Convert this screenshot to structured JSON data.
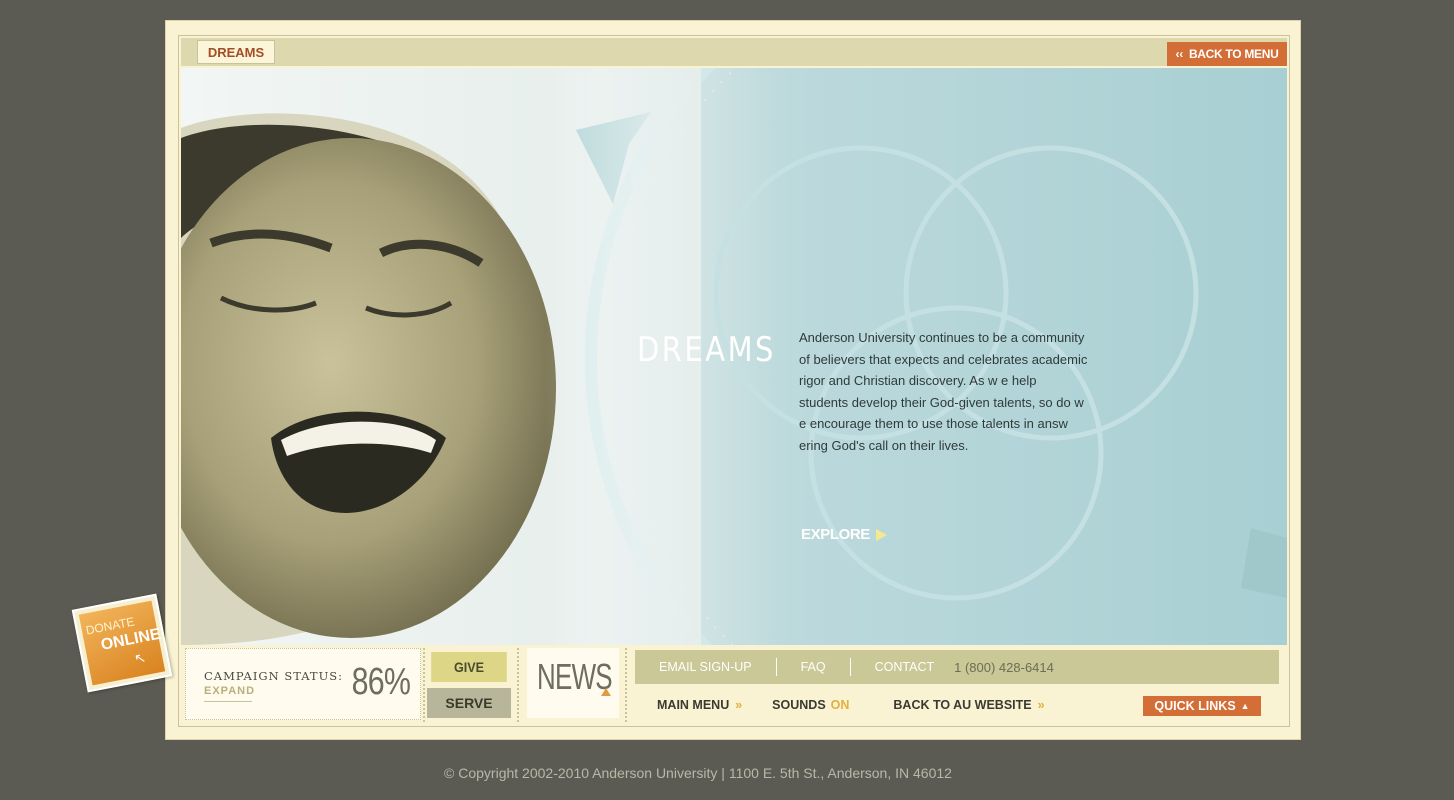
{
  "header": {
    "crumb_label": "DREAMS",
    "back_label": "BACK TO MENU",
    "back_icon": "double-chevron-left-icon"
  },
  "hero": {
    "title": "DREAMS",
    "body": "Anderson University continues to be a community of believers that expects and celebrates academic rigor and Christian discovery. As w e help students develop their God-given talents, so do w e encourage them to use those talents in answ ering God's call on their lives.",
    "explore_label": "EXPLORE",
    "accent_color": "#a8cfd3"
  },
  "campaign": {
    "label": "CAMPAIGN STATUS:",
    "expand_label": "EXPAND",
    "percent_text": "86%",
    "percent_value": 86
  },
  "actions": {
    "give_label": "GIVE",
    "serve_label": "SERVE",
    "news_label": "NEWS"
  },
  "links": {
    "email_label": "EMAIL SIGN-UP",
    "faq_label": "FAQ",
    "contact_label": "CONTACT",
    "phone": "1 (800) 428-6414",
    "main_menu_label": "MAIN MENU",
    "sounds_label": "SOUNDS",
    "sounds_state": "ON",
    "back_au_label": "BACK TO AU WEBSITE",
    "quick_links_label": "QUICK LINKS",
    "arrow_glyph": "»"
  },
  "donate": {
    "line1": "DONATE",
    "line2": "ONLINE"
  },
  "footer": {
    "text": "© Copyright 2002-2010 Anderson University   |  1100 E. 5th St., Anderson, IN 46012"
  },
  "colors": {
    "background": "#5b5b53",
    "frame": "#f9f3d3",
    "orange": "#d36e37"
  }
}
